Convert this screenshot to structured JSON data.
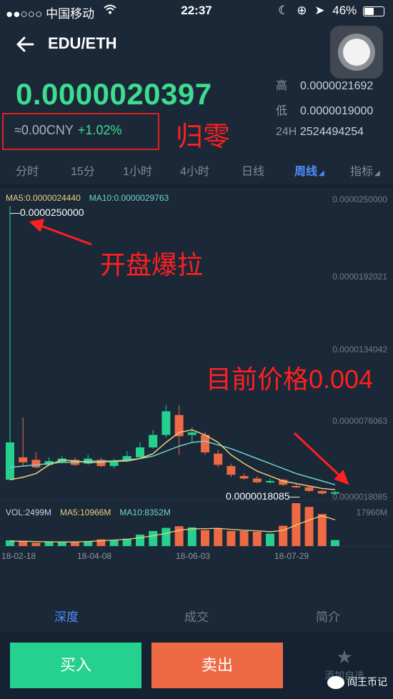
{
  "status_bar": {
    "carrier": "●●○○○ 中国移动",
    "time": "22:37",
    "battery": "46%"
  },
  "nav": {
    "pair": "EDU/ETH"
  },
  "price": {
    "last": "0.0000020397",
    "cny": "≈0.00CNY",
    "change": "+1.02%"
  },
  "stats": [
    {
      "label": "高",
      "value": "0.0000021692"
    },
    {
      "label": "低",
      "value": "0.0000019000"
    },
    {
      "label": "24H",
      "value": "2524494254"
    }
  ],
  "tabs": [
    "分时",
    "15分",
    "1小时",
    "4小时",
    "日线",
    "周线",
    "指标"
  ],
  "active_tab": "周线",
  "chart": {
    "ma5_label": "MA5:0.0000024440",
    "ma10_label": "MA10:0.0000029763",
    "y_ticks": [
      "0.0000250000",
      "0.0000192021",
      "0.0000134042",
      "0.0000076063",
      "0.0000018085"
    ],
    "max_label": "0.0000250000",
    "min_label": "0.0000018085",
    "x_ticks": [
      "18-02-18",
      "18-04-08",
      "18-06-03",
      "18-07-29"
    ]
  },
  "volume": {
    "vol_label": "VOL:2499M",
    "ma5_label": "MA5:10966M",
    "ma10_label": "MA10:8352M",
    "max": "17960M"
  },
  "lower_tabs": [
    "深度",
    "成交",
    "简介"
  ],
  "buttons": {
    "buy": "买入",
    "sell": "卖出",
    "fav": "添加自选"
  },
  "annotations": {
    "zero": "归零",
    "pump": "开盘爆拉",
    "current": "目前价格0.004"
  },
  "watermark": "阎王币记",
  "colors": {
    "up": "#26d08f",
    "down": "#ee6a45",
    "accent": "#4f8fff",
    "annotation": "#ff2020"
  },
  "chart_data": {
    "type": "candlestick",
    "ylim": [
      1.8085e-06,
      2.5e-05
    ],
    "candles": [
      {
        "open": 3e-06,
        "close": 6e-06,
        "high": 2.5e-05,
        "low": 3e-06
      },
      {
        "open": 4.8e-06,
        "close": 4.4e-06,
        "high": 8e-06,
        "low": 4.1e-06
      },
      {
        "open": 4.6e-06,
        "close": 4e-06,
        "high": 5.2e-06,
        "low": 3.9e-06
      },
      {
        "open": 4.2e-06,
        "close": 4.5e-06,
        "high": 4.8e-06,
        "low": 4.1e-06
      },
      {
        "open": 4.4e-06,
        "close": 4.7e-06,
        "high": 4.9e-06,
        "low": 4.3e-06
      },
      {
        "open": 4.6e-06,
        "close": 4.2e-06,
        "high": 4.8e-06,
        "low": 4.1e-06
      },
      {
        "open": 4.3e-06,
        "close": 4.7e-06,
        "high": 5e-06,
        "low": 4.2e-06
      },
      {
        "open": 4.6e-06,
        "close": 4.1e-06,
        "high": 4.8e-06,
        "low": 4e-06
      },
      {
        "open": 4.1e-06,
        "close": 4.5e-06,
        "high": 4.7e-06,
        "low": 3.9e-06
      },
      {
        "open": 4.6e-06,
        "close": 4.9e-06,
        "high": 5.3e-06,
        "low": 4.5e-06
      },
      {
        "open": 4.8e-06,
        "close": 5.6e-06,
        "high": 6e-06,
        "low": 4.7e-06
      },
      {
        "open": 5.6e-06,
        "close": 6.6e-06,
        "high": 7e-06,
        "low": 5.5e-06
      },
      {
        "open": 6.6e-06,
        "close": 8.5e-06,
        "high": 9e-06,
        "low": 6.4e-06
      },
      {
        "open": 8.2e-06,
        "close": 6.5e-06,
        "high": 9e-06,
        "low": 5e-06
      },
      {
        "open": 6.6e-06,
        "close": 6.8e-06,
        "high": 7.2e-06,
        "low": 6e-06
      },
      {
        "open": 6.6e-06,
        "close": 5.2e-06,
        "high": 6.8e-06,
        "low": 5e-06
      },
      {
        "open": 5.1e-06,
        "close": 4.2e-06,
        "high": 5.4e-06,
        "low": 4e-06
      },
      {
        "open": 4.1e-06,
        "close": 3.4e-06,
        "high": 4.3e-06,
        "low": 3.2e-06
      },
      {
        "open": 3.3e-06,
        "close": 3.1e-06,
        "high": 3.5e-06,
        "low": 3e-06
      },
      {
        "open": 3.1e-06,
        "close": 2.8e-06,
        "high": 3.3e-06,
        "low": 2.7e-06
      },
      {
        "open": 2.8e-06,
        "close": 2.9e-06,
        "high": 3.1e-06,
        "low": 2.7e-06
      },
      {
        "open": 3e-06,
        "close": 2.6e-06,
        "high": 3.1e-06,
        "low": 2.5e-06
      },
      {
        "open": 2.5e-06,
        "close": 2.4e-06,
        "high": 2.7e-06,
        "low": 2.3e-06
      },
      {
        "open": 2.4e-06,
        "close": 2.1e-06,
        "high": 2.5e-06,
        "low": 2e-06
      },
      {
        "open": 2.1e-06,
        "close": 1.9e-06,
        "high": 2.2e-06,
        "low": 1.8085e-06
      },
      {
        "open": 1.9e-06,
        "close": 2e-06,
        "high": 2.1e-06,
        "low": 1.8e-06
      }
    ],
    "ma5": [
      3e-06,
      3.2e-06,
      3.5e-06,
      4.2e-06,
      4.6e-06,
      4.5e-06,
      4.4e-06,
      4.4e-06,
      4.5e-06,
      4.5e-06,
      4.7e-06,
      5.1e-06,
      6e-06,
      6.8e-06,
      7e-06,
      6.6e-06,
      6e-06,
      5e-06,
      4.3e-06,
      3.7e-06,
      3.3e-06,
      2.9e-06,
      2.7e-06,
      2.5e-06,
      2.3e-06,
      2.2e-06
    ],
    "ma10": [
      4e-06,
      4.1e-06,
      4.2e-06,
      4.3e-06,
      4.4e-06,
      4.4e-06,
      4.5e-06,
      4.5e-06,
      4.5e-06,
      4.6e-06,
      4.7e-06,
      4.9e-06,
      5.3e-06,
      5.7e-06,
      6e-06,
      6.1e-06,
      5.8e-06,
      5.5e-06,
      5.1e-06,
      4.7e-06,
      4.3e-06,
      3.9e-06,
      3.5e-06,
      3.2e-06,
      2.9e-06,
      2.6e-06
    ],
    "volumes": [
      2400,
      2000,
      1400,
      1800,
      1600,
      1500,
      1800,
      2800,
      2600,
      3100,
      4800,
      6300,
      7600,
      8300,
      7800,
      6700,
      7400,
      6300,
      6300,
      6000,
      5200,
      8500,
      17960,
      16400,
      13400,
      2499
    ],
    "volume_ma5": [
      2000,
      2000,
      1900,
      1800,
      1700,
      1700,
      1900,
      2200,
      2500,
      2800,
      3500,
      4300,
      5300,
      6600,
      7200,
      7300,
      7400,
      7000,
      6600,
      6400,
      6000,
      6500,
      8800,
      10900,
      12700,
      10966
    ]
  }
}
